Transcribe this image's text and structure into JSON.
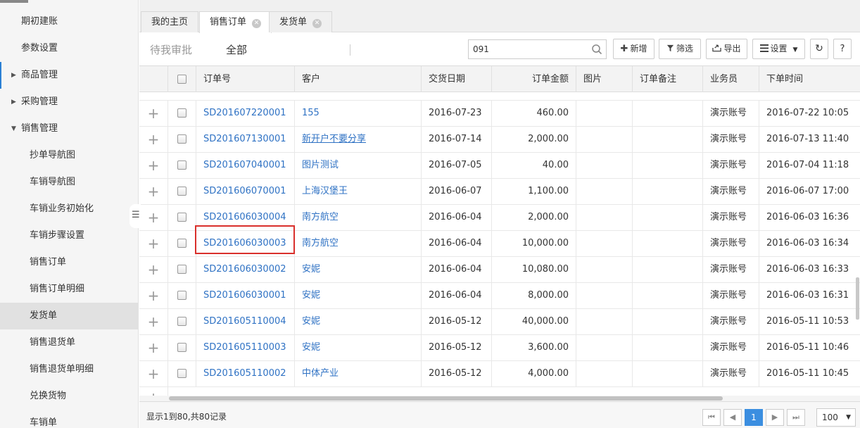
{
  "sidebar": {
    "items": [
      {
        "label": "期初建账",
        "level": 0,
        "arrow": ""
      },
      {
        "label": "参数设置",
        "level": 0,
        "arrow": ""
      },
      {
        "label": "商品管理",
        "level": 0,
        "arrow": "▶"
      },
      {
        "label": "采购管理",
        "level": 0,
        "arrow": "▶"
      },
      {
        "label": "销售管理",
        "level": 0,
        "arrow": "▼"
      },
      {
        "label": "抄单导航图",
        "level": 1,
        "arrow": ""
      },
      {
        "label": "车销导航图",
        "level": 1,
        "arrow": ""
      },
      {
        "label": "车销业务初始化",
        "level": 1,
        "arrow": ""
      },
      {
        "label": "车销步骤设置",
        "level": 1,
        "arrow": ""
      },
      {
        "label": "销售订单",
        "level": 1,
        "arrow": ""
      },
      {
        "label": "销售订单明细",
        "level": 1,
        "arrow": ""
      },
      {
        "label": "发货单",
        "level": 1,
        "arrow": "",
        "active": true
      },
      {
        "label": "销售退货单",
        "level": 1,
        "arrow": ""
      },
      {
        "label": "销售退货单明细",
        "level": 1,
        "arrow": ""
      },
      {
        "label": "兑换货物",
        "level": 1,
        "arrow": ""
      },
      {
        "label": "车销单",
        "level": 1,
        "arrow": ""
      }
    ]
  },
  "tabs": [
    {
      "label": "我的主页",
      "closable": false
    },
    {
      "label": "销售订单",
      "closable": true,
      "active": true
    },
    {
      "label": "发货单",
      "closable": true
    }
  ],
  "toolbar": {
    "filter_pending": "待我审批",
    "filter_all": "全部",
    "search_value": "091",
    "add_label": "新增",
    "filter_label": "筛选",
    "export_label": "导出",
    "settings_label": "设置"
  },
  "table": {
    "columns": [
      "订单号",
      "客户",
      "交货日期",
      "订单金额",
      "图片",
      "订单备注",
      "业务员",
      "下单时间"
    ],
    "rows": [
      {
        "order": "SD201607220001",
        "customer": "155",
        "date": "2016-07-23",
        "amount": "460.00",
        "image": "",
        "note": "",
        "sales": "演示账号",
        "time": "2016-07-22 10:05",
        "underline": false
      },
      {
        "order": "SD201607130001",
        "customer": "新开户不要分享",
        "date": "2016-07-14",
        "amount": "2,000.00",
        "image": "",
        "note": "",
        "sales": "演示账号",
        "time": "2016-07-13 11:40",
        "underline": true
      },
      {
        "order": "SD201607040001",
        "customer": "图片测试",
        "date": "2016-07-05",
        "amount": "40.00",
        "image": "",
        "note": "",
        "sales": "演示账号",
        "time": "2016-07-04 11:18",
        "underline": false
      },
      {
        "order": "SD201606070001",
        "customer": "上海汉堡王",
        "date": "2016-06-07",
        "amount": "1,100.00",
        "image": "",
        "note": "",
        "sales": "演示账号",
        "time": "2016-06-07 17:00",
        "underline": false
      },
      {
        "order": "SD201606030004",
        "customer": "南方航空",
        "date": "2016-06-04",
        "amount": "2,000.00",
        "image": "",
        "note": "",
        "sales": "演示账号",
        "time": "2016-06-03 16:36",
        "underline": false
      },
      {
        "order": "SD201606030003",
        "customer": "南方航空",
        "date": "2016-06-04",
        "amount": "10,000.00",
        "image": "",
        "note": "",
        "sales": "演示账号",
        "time": "2016-06-03 16:34",
        "underline": false
      },
      {
        "order": "SD201606030002",
        "customer": "安妮",
        "date": "2016-06-04",
        "amount": "10,080.00",
        "image": "",
        "note": "",
        "sales": "演示账号",
        "time": "2016-06-03 16:33",
        "underline": false
      },
      {
        "order": "SD201606030001",
        "customer": "安妮",
        "date": "2016-06-04",
        "amount": "8,000.00",
        "image": "",
        "note": "",
        "sales": "演示账号",
        "time": "2016-06-03 16:31",
        "underline": false
      },
      {
        "order": "SD201605110004",
        "customer": "安妮",
        "date": "2016-05-12",
        "amount": "40,000.00",
        "image": "",
        "note": "",
        "sales": "演示账号",
        "time": "2016-05-11 10:53",
        "underline": false
      },
      {
        "order": "SD201605110003",
        "customer": "安妮",
        "date": "2016-05-12",
        "amount": "3,600.00",
        "image": "",
        "note": "",
        "sales": "演示账号",
        "time": "2016-05-11 10:46",
        "underline": false
      },
      {
        "order": "SD201605110002",
        "customer": "中体产业",
        "date": "2016-05-12",
        "amount": "4,000.00",
        "image": "",
        "note": "",
        "sales": "演示账号",
        "time": "2016-05-11 10:45",
        "underline": false
      }
    ]
  },
  "footer": {
    "info": "显示1到80,共80记录",
    "current_page": "1",
    "page_size": "100"
  },
  "colors": {
    "link": "#2f72c4",
    "accent": "#3b8ee0",
    "highlight": "#d9302c"
  }
}
